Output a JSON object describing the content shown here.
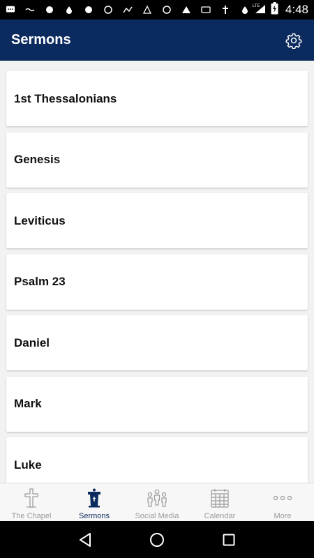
{
  "status_bar": {
    "time": "4:48",
    "network": "LTE",
    "notification_icons": [
      "message-icon",
      "mail-icon",
      "app-icon",
      "drop-icon",
      "app-icon",
      "app-icon",
      "app-icon",
      "app-icon",
      "app-icon",
      "app-icon",
      "app-icon",
      "drop-icon"
    ]
  },
  "app_bar": {
    "title": "Sermons",
    "settings_icon": "gear-icon"
  },
  "sermons": [
    {
      "label": "1st Thessalonians"
    },
    {
      "label": "Genesis"
    },
    {
      "label": "Leviticus"
    },
    {
      "label": "Psalm 23"
    },
    {
      "label": "Daniel"
    },
    {
      "label": "Mark"
    },
    {
      "label": "Luke"
    }
  ],
  "tabs": [
    {
      "label": "The Chapel",
      "icon": "cross-icon",
      "active": false
    },
    {
      "label": "Sermons",
      "icon": "pulpit-icon",
      "active": true
    },
    {
      "label": "Social Media",
      "icon": "people-icon",
      "active": false
    },
    {
      "label": "Calendar",
      "icon": "calendar-icon",
      "active": false
    },
    {
      "label": "More",
      "icon": "more-icon",
      "active": false
    }
  ],
  "colors": {
    "app_bar": "#0b2a5e",
    "active_tab": "#0b2a5e",
    "inactive_tab": "#9a9a9a",
    "background": "#f2f2f2"
  }
}
